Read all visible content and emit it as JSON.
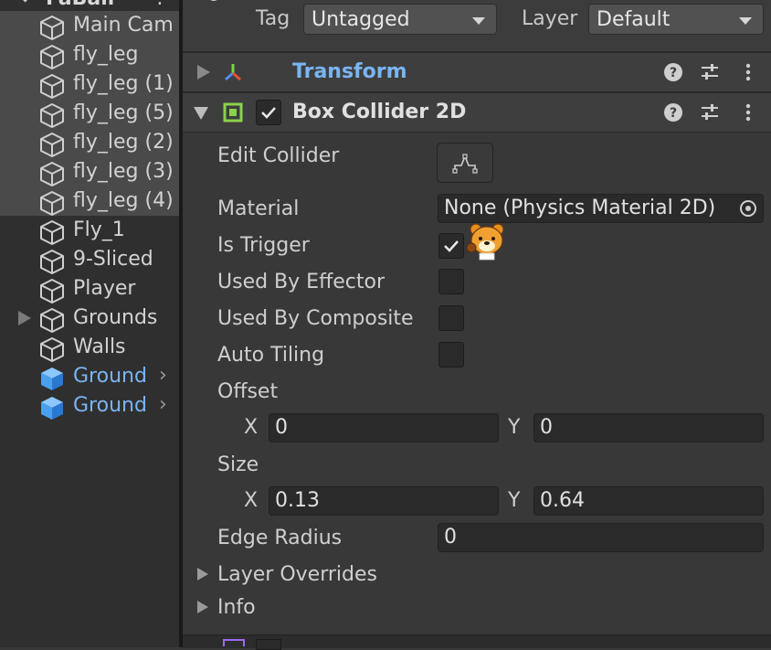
{
  "hierarchy": {
    "root_label": "FaBall",
    "items": [
      {
        "label": "Main Cam",
        "selected": true,
        "blue": false
      },
      {
        "label": "fly_leg",
        "selected": true,
        "blue": false
      },
      {
        "label": "fly_leg (1)",
        "selected": true,
        "blue": false
      },
      {
        "label": "fly_leg (5)",
        "selected": true,
        "blue": false
      },
      {
        "label": "fly_leg (2)",
        "selected": true,
        "blue": false
      },
      {
        "label": "fly_leg (3)",
        "selected": true,
        "blue": false
      },
      {
        "label": "fly_leg (4)",
        "selected": true,
        "blue": false
      },
      {
        "label": "Fly_1",
        "selected": false,
        "blue": false
      },
      {
        "label": "9-Sliced",
        "selected": false,
        "blue": false
      },
      {
        "label": "Player",
        "selected": false,
        "blue": false
      },
      {
        "label": "Grounds",
        "selected": false,
        "blue": false,
        "foldout": true
      },
      {
        "label": "Walls",
        "selected": false,
        "blue": false
      },
      {
        "label": "Ground",
        "selected": false,
        "blue": true,
        "chevron": true
      },
      {
        "label": "Ground",
        "selected": false,
        "blue": true,
        "chevron": true
      }
    ]
  },
  "inspector": {
    "tag_label": "Tag",
    "tag_value": "Untagged",
    "layer_label": "Layer",
    "layer_value": "Default",
    "transform": {
      "title": "Transform"
    },
    "box_collider": {
      "title": "Box Collider 2D",
      "enabled": true,
      "edit_collider_label": "Edit Collider",
      "material_label": "Material",
      "material_value": "None (Physics Material 2D)",
      "is_trigger_label": "Is Trigger",
      "is_trigger": true,
      "used_by_effector_label": "Used By Effector",
      "used_by_effector": false,
      "used_by_composite_label": "Used By Composite",
      "used_by_composite": false,
      "auto_tiling_label": "Auto Tiling",
      "auto_tiling": false,
      "offset_label": "Offset",
      "offset_x_label": "X",
      "offset_x": "0",
      "offset_y_label": "Y",
      "offset_y": "0",
      "size_label": "Size",
      "size_x_label": "X",
      "size_x": "0.13",
      "size_y_label": "Y",
      "size_y": "0.64",
      "edge_radius_label": "Edge Radius",
      "edge_radius": "0",
      "layer_overrides_label": "Layer Overrides",
      "info_label": "Info"
    }
  },
  "icons": {
    "cube": "gameobject-cube-icon",
    "prefab": "prefab-cube-icon",
    "help": "help-icon",
    "presets": "presets-icon",
    "menu": "kebab-menu-icon",
    "sticker": "bear-sticker-icon"
  },
  "colors": {
    "accent_blue": "#7ab4f2",
    "collider_green": "#8bd14a",
    "panel_bg": "#383838",
    "hierarchy_bg": "#2f2f2f"
  }
}
